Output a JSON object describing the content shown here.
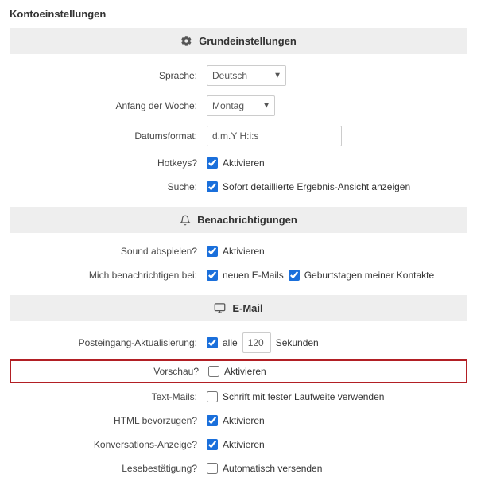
{
  "page": {
    "title": "Kontoeinstellungen"
  },
  "sections": {
    "basic": {
      "title": "Grundeinstellungen",
      "fields": {
        "language": {
          "label": "Sprache:",
          "selected": "Deutsch"
        },
        "weekstart": {
          "label": "Anfang der Woche:",
          "selected": "Montag"
        },
        "dateformat": {
          "label": "Datumsformat:",
          "value": "d.m.Y H:i:s"
        },
        "hotkeys": {
          "label": "Hotkeys?",
          "checked": true,
          "option": "Aktivieren"
        },
        "search": {
          "label": "Suche:",
          "checked": true,
          "option": "Sofort detaillierte Ergebnis-Ansicht anzeigen"
        }
      }
    },
    "notifications": {
      "title": "Benachrichtigungen",
      "fields": {
        "sound": {
          "label": "Sound abspielen?",
          "checked": true,
          "option": "Aktivieren"
        },
        "notifyon": {
          "label": "Mich benachrichtigen bei:",
          "email": {
            "checked": true,
            "option": "neuen E-Mails"
          },
          "bday": {
            "checked": true,
            "option": "Geburtstagen meiner Kontakte"
          }
        }
      }
    },
    "email": {
      "title": "E-Mail",
      "fields": {
        "refresh": {
          "label": "Posteingang-Aktualisierung:",
          "checked": true,
          "prefix": "alle",
          "value": "120",
          "suffix": "Sekunden"
        },
        "preview": {
          "label": "Vorschau?",
          "checked": false,
          "option": "Aktivieren"
        },
        "textmails": {
          "label": "Text-Mails:",
          "checked": false,
          "option": "Schrift mit fester Laufweite verwenden"
        },
        "preferhtml": {
          "label": "HTML bevorzugen?",
          "checked": true,
          "option": "Aktivieren"
        },
        "conversation": {
          "label": "Konversations-Anzeige?",
          "checked": true,
          "option": "Aktivieren"
        },
        "readreceipt": {
          "label": "Lesebestätigung?",
          "checked": false,
          "option": "Automatisch versenden"
        }
      }
    }
  }
}
